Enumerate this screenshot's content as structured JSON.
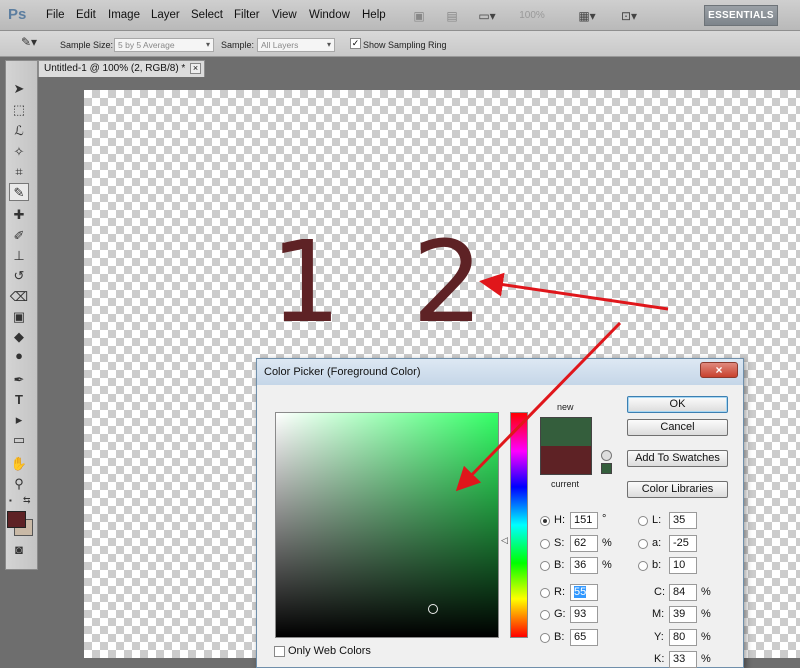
{
  "menubar": {
    "logo": "Ps",
    "items": [
      "File",
      "Edit",
      "Image",
      "Layer",
      "Select",
      "Filter",
      "View",
      "Window",
      "Help"
    ],
    "zoom": "100%",
    "workspace": "ESSENTIALS"
  },
  "options": {
    "sample_size_label": "Sample Size:",
    "sample_size_value": "5 by 5 Average",
    "sample_label": "Sample:",
    "sample_value": "All Layers",
    "sampling_ring_label": "Show Sampling Ring"
  },
  "document": {
    "tab_title": "Untitled-1 @ 100% (2, RGB/8) *",
    "canvas_text_1": "1",
    "canvas_text_2": "2"
  },
  "dialog": {
    "title": "Color Picker (Foreground Color)",
    "new_label": "new",
    "current_label": "current",
    "new_color": "#345e3c",
    "current_color": "#5e2225",
    "buttons": {
      "ok": "OK",
      "cancel": "Cancel",
      "add_to_swatches": "Add To Swatches",
      "color_libraries": "Color Libraries"
    },
    "hsb": {
      "h_label": "H:",
      "h_value": "151",
      "h_unit": "°",
      "s_label": "S:",
      "s_value": "62",
      "s_unit": "%",
      "b_label": "B:",
      "b_value": "36",
      "b_unit": "%"
    },
    "rgb": {
      "r_label": "R:",
      "r_value": "55",
      "g_label": "G:",
      "g_value": "93",
      "b_label": "B:",
      "b_value": "65"
    },
    "lab": {
      "l_label": "L:",
      "l_value": "35",
      "a_label": "a:",
      "a_value": "-25",
      "b_label": "b:",
      "b_value": "10"
    },
    "cmyk": {
      "c_label": "C:",
      "c_value": "84",
      "c_unit": "%",
      "m_label": "M:",
      "m_value": "39",
      "m_unit": "%",
      "y_label": "Y:",
      "y_value": "80",
      "y_unit": "%",
      "k_label": "K:",
      "k_value": "33",
      "k_unit": "%"
    },
    "only_web_colors": "Only Web Colors"
  },
  "colors": {
    "annotation_arrow": "#e0161b",
    "foreground": "#5e2225",
    "background": "#c9b9a6"
  }
}
